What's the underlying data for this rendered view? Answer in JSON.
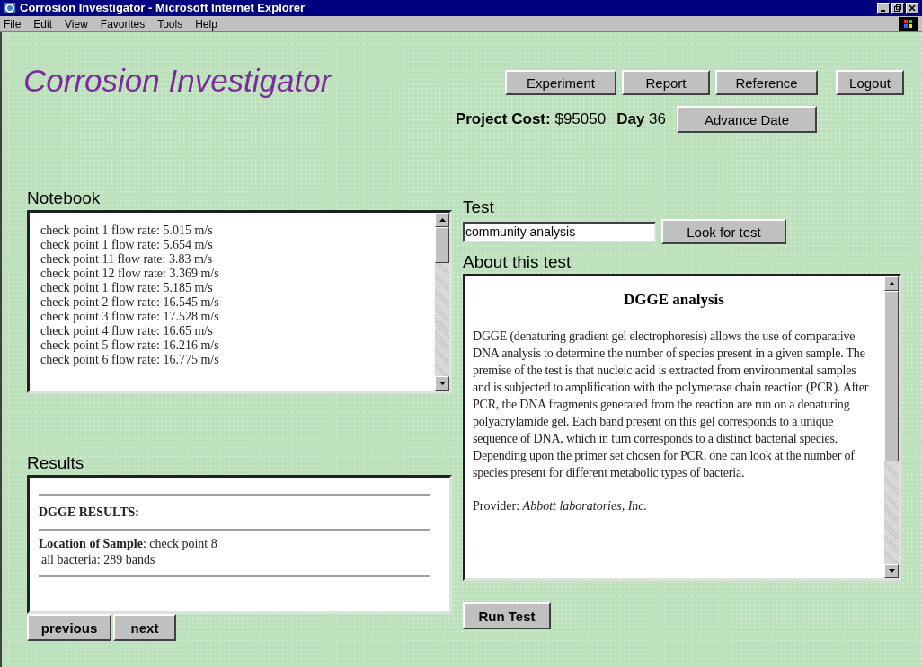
{
  "window": {
    "title": "Corrosion Investigator - Microsoft Internet Explorer"
  },
  "menu": [
    "File",
    "Edit",
    "View",
    "Favorites",
    "Tools",
    "Help"
  ],
  "app_title": "Corrosion Investigator",
  "nav_buttons": [
    "Experiment",
    "Report",
    "Reference",
    "Logout"
  ],
  "status": {
    "cost_label": "Project Cost:",
    "cost": "$95050",
    "day_label": "Day",
    "day": "36",
    "advance_button": "Advance Date"
  },
  "notebook": {
    "heading": "Notebook",
    "entries": [
      "check point 1 flow rate: 5.015 m/s",
      "check point 1 flow rate: 5.654 m/s",
      "check point 11 flow rate: 3.83 m/s",
      "check point 12 flow rate: 3.369 m/s",
      "check point 1 flow rate: 5.185 m/s",
      "check point 2 flow rate: 16.545 m/s",
      "check point 3 flow rate: 17.528 m/s",
      "check point 4 flow rate: 16.65 m/s",
      "check point 5 flow rate: 16.216 m/s",
      "check point 6 flow rate: 16.775 m/s"
    ]
  },
  "results": {
    "heading": "Results",
    "title": "DGGE RESULTS:",
    "lines": [
      "**Location of Sample**: check point 8",
      "all bacteria: 289 bands"
    ],
    "buttons": [
      "previous",
      "next"
    ]
  },
  "test": {
    "heading": "Test",
    "value": "community analysis",
    "button": "Look for test"
  },
  "about": {
    "heading": "About this test",
    "title": "DGGE analysis",
    "body": "DGGE (denaturing gradient gel electrophoresis) allows the use of comparative DNA analysis to determine the number of species present in a given sample. The premise of the test is that nucleic acid is extracted from environmental samples and is subjected to amplification with the polymerase chain reaction (PCR). After PCR, the DNA fragments generated from the reaction are run on a denaturing polyacrylamide gel. Each band present on this gel corresponds to a unique sequence of DNA, which in turn corresponds to a distinct bacterial species. Depending upon the primer set chosen for PCR, one can look at the number of species present for different metabolic types of bacteria.",
    "provider": "Provider: *Abbott laboratories, Inc.*"
  },
  "run_button": "Run Test"
}
